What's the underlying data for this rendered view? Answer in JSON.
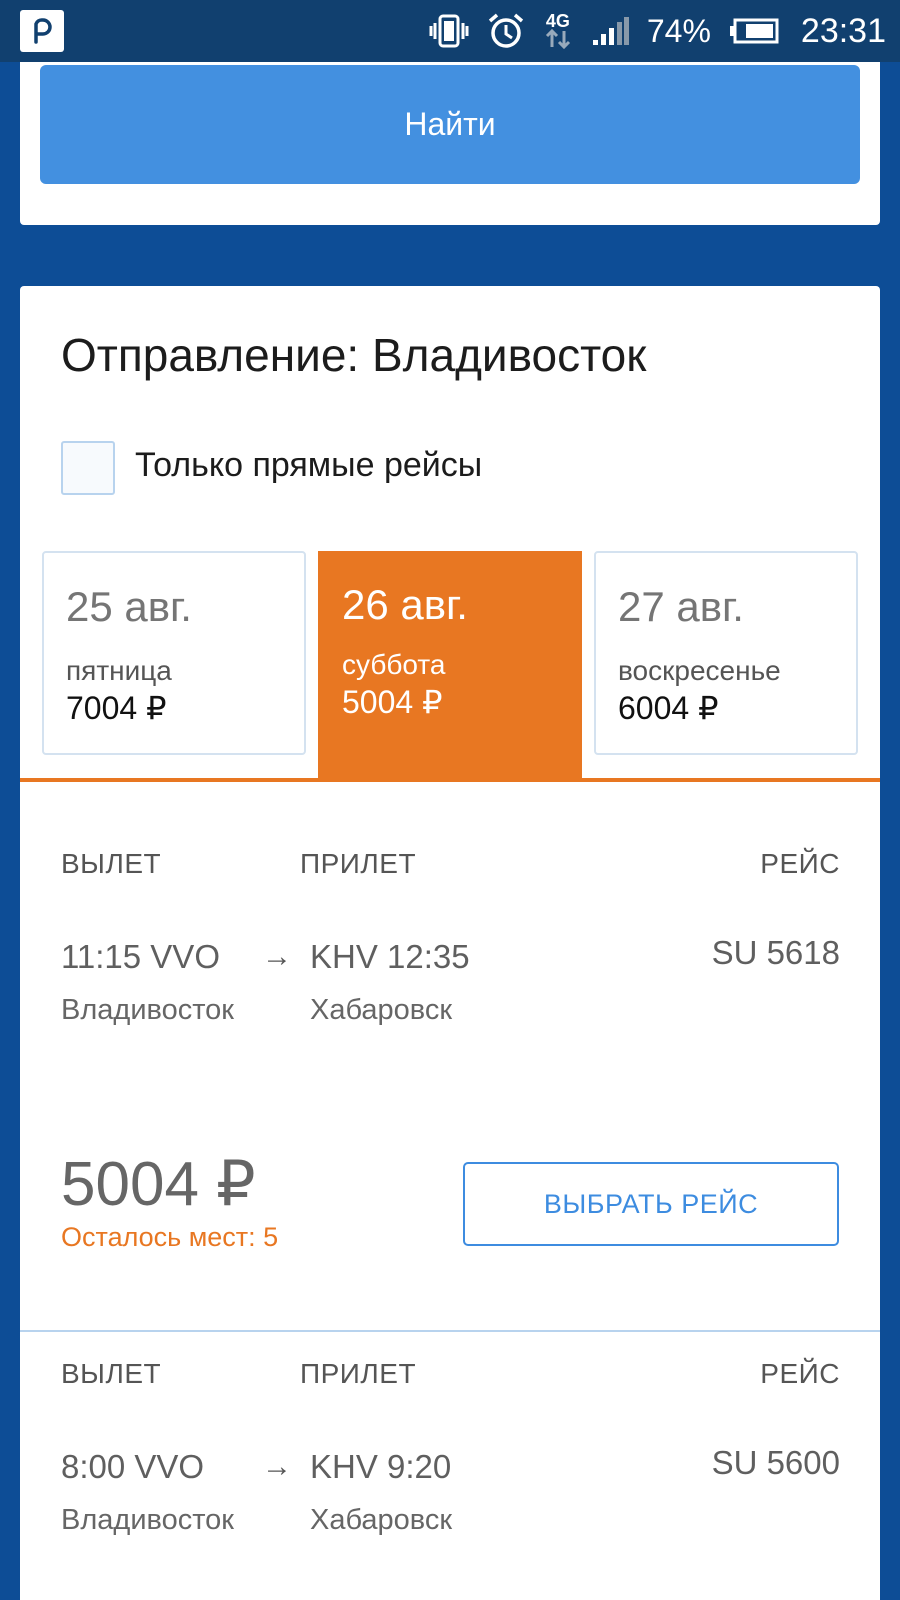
{
  "status_bar": {
    "app_icon": "rutaxi-logo-icon",
    "net_type": "4G",
    "battery": "74%",
    "time": "23:31",
    "icons": [
      "vibrate-icon",
      "alarm-icon",
      "network-4g-icon",
      "signal-icon",
      "battery-icon"
    ]
  },
  "search": {
    "find_label": "Найти"
  },
  "results": {
    "title": "Отправление: Владивосток",
    "direct_only_label": "Только прямые рейсы",
    "direct_only_checked": false,
    "dates": [
      {
        "date": "25 авг.",
        "weekday": "пятница",
        "price": "7004 ₽",
        "active": false
      },
      {
        "date": "26 авг.",
        "weekday": "суббота",
        "price": "5004 ₽",
        "active": true
      },
      {
        "date": "27 авг.",
        "weekday": "воскресенье",
        "price": "6004 ₽",
        "active": false
      }
    ],
    "headers": {
      "departure": "ВЫЛЕТ",
      "arrival": "ПРИЛЕТ",
      "flight": "РЕЙС"
    },
    "flights": [
      {
        "dep_time": "11:15 VVO",
        "dep_city": "Владивосток",
        "arrow": "→",
        "arr_time": "KHV 12:35",
        "arr_city": "Хабаровск",
        "flight_no": "SU 5618",
        "price": "5004 ₽",
        "seats": "Осталось мест: 5",
        "select_label": "ВЫБРАТЬ РЕЙС"
      },
      {
        "dep_time": "8:00 VVO",
        "dep_city": "Владивосток",
        "arrow": "→",
        "arr_time": "KHV 9:20",
        "arr_city": "Хабаровск",
        "flight_no": "SU 5600"
      }
    ]
  },
  "colors": {
    "background": "#0d4d96",
    "status_bar": "#11406f",
    "primary_button": "#4390e0",
    "accent": "#e87722",
    "link": "#3d8ce0"
  }
}
